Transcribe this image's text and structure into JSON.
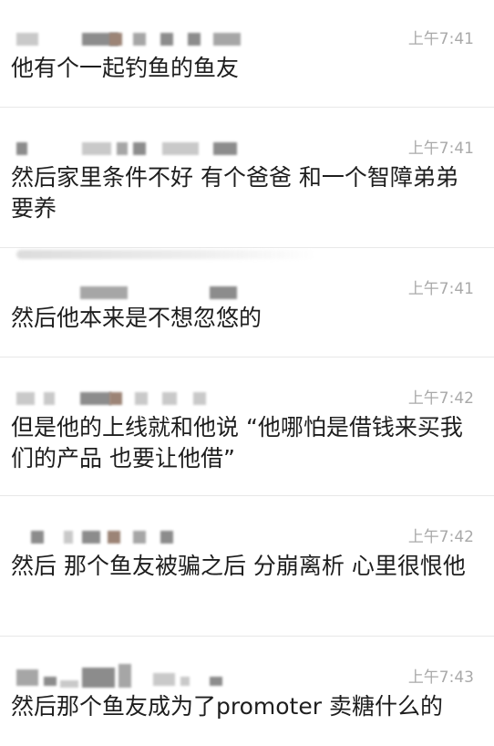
{
  "messages": [
    {
      "time": "上午7:41",
      "text": "他有个一起钓鱼的鱼友"
    },
    {
      "time": "上午7:41",
      "text": "然后家里条件不好 有个爸爸 和一个智障弟弟要养"
    },
    {
      "time": "上午7:41",
      "text": "然后他本来是不想忽悠的"
    },
    {
      "time": "上午7:42",
      "text": "但是他的上线就和他说 “他哪怕是借钱来买我们的产品 也要让他借”"
    },
    {
      "time": "上午7:42",
      "text": "然后 那个鱼友被骗之后 分崩离析 心里很恨他"
    },
    {
      "time": "上午7:43",
      "text": "然后那个鱼友成为了promoter 卖糖什么的"
    }
  ],
  "colors": {
    "background": "#ffffff",
    "message_text": "#1e1e1e",
    "timestamp": "#a9a9a9",
    "divider": "#e8e8e8",
    "redaction": "#8c8c8c"
  },
  "icons": [
    "redacted-sender-name"
  ]
}
